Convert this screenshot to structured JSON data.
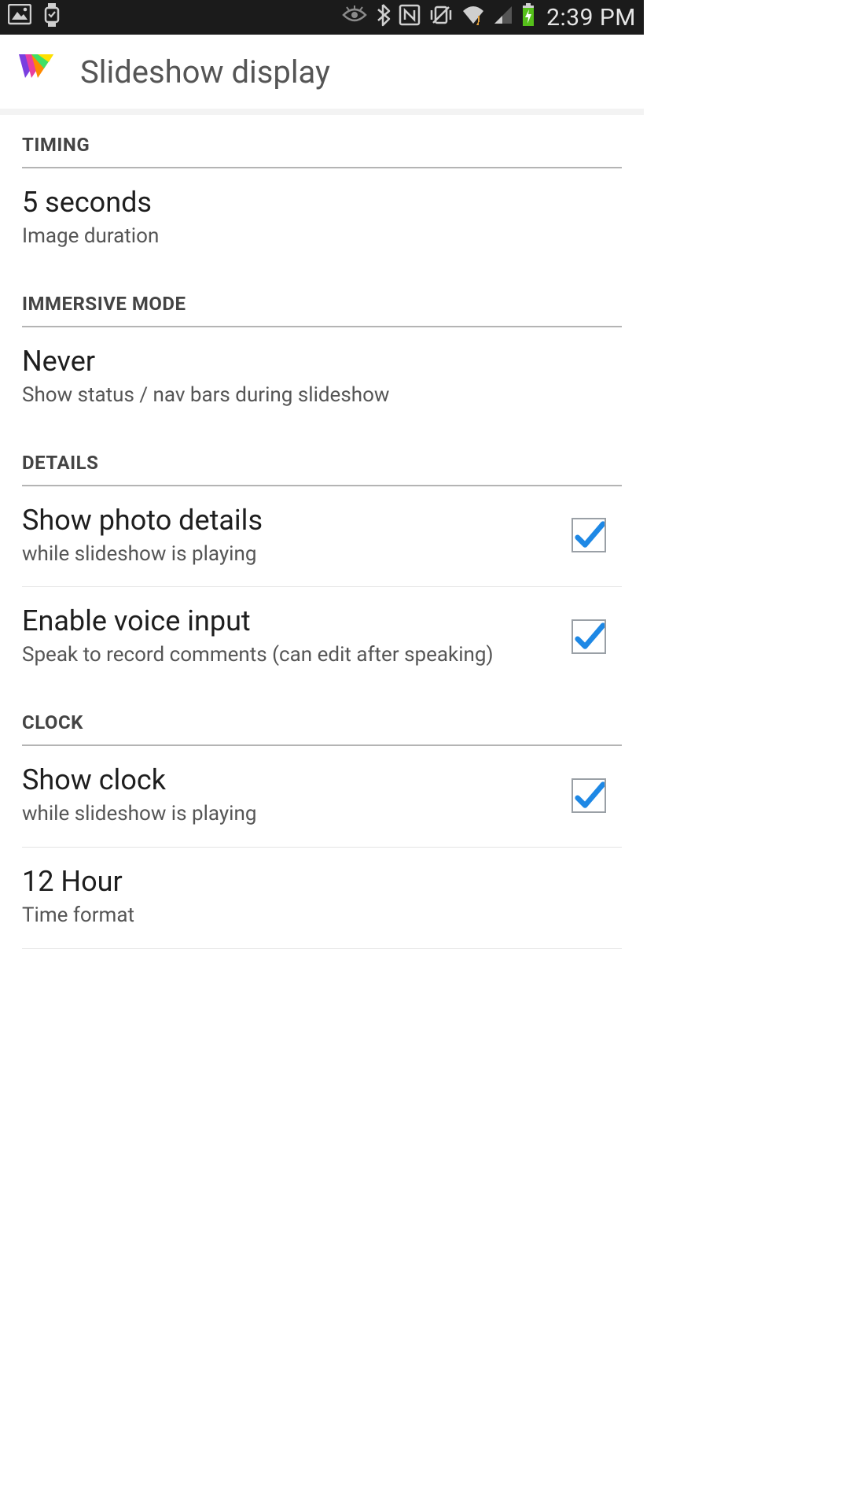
{
  "status_bar": {
    "time": "2:39 PM"
  },
  "header": {
    "title": "Slideshow display"
  },
  "sections": {
    "timing": {
      "label": "TIMING",
      "duration": {
        "title": "5 seconds",
        "summary": "Image duration"
      }
    },
    "immersive": {
      "label": "IMMERSIVE MODE",
      "mode": {
        "title": "Never",
        "summary": "Show status / nav bars during slideshow"
      }
    },
    "details": {
      "label": "DETAILS",
      "show_details": {
        "title": "Show photo details",
        "summary": "while slideshow is playing",
        "checked": true
      },
      "voice_input": {
        "title": "Enable voice input",
        "summary": "Speak to record comments (can edit after speaking)",
        "checked": true
      }
    },
    "clock": {
      "label": "CLOCK",
      "show_clock": {
        "title": "Show clock",
        "summary": "while slideshow is playing",
        "checked": true
      },
      "time_format": {
        "title": "12 Hour",
        "summary": "Time format"
      }
    }
  }
}
